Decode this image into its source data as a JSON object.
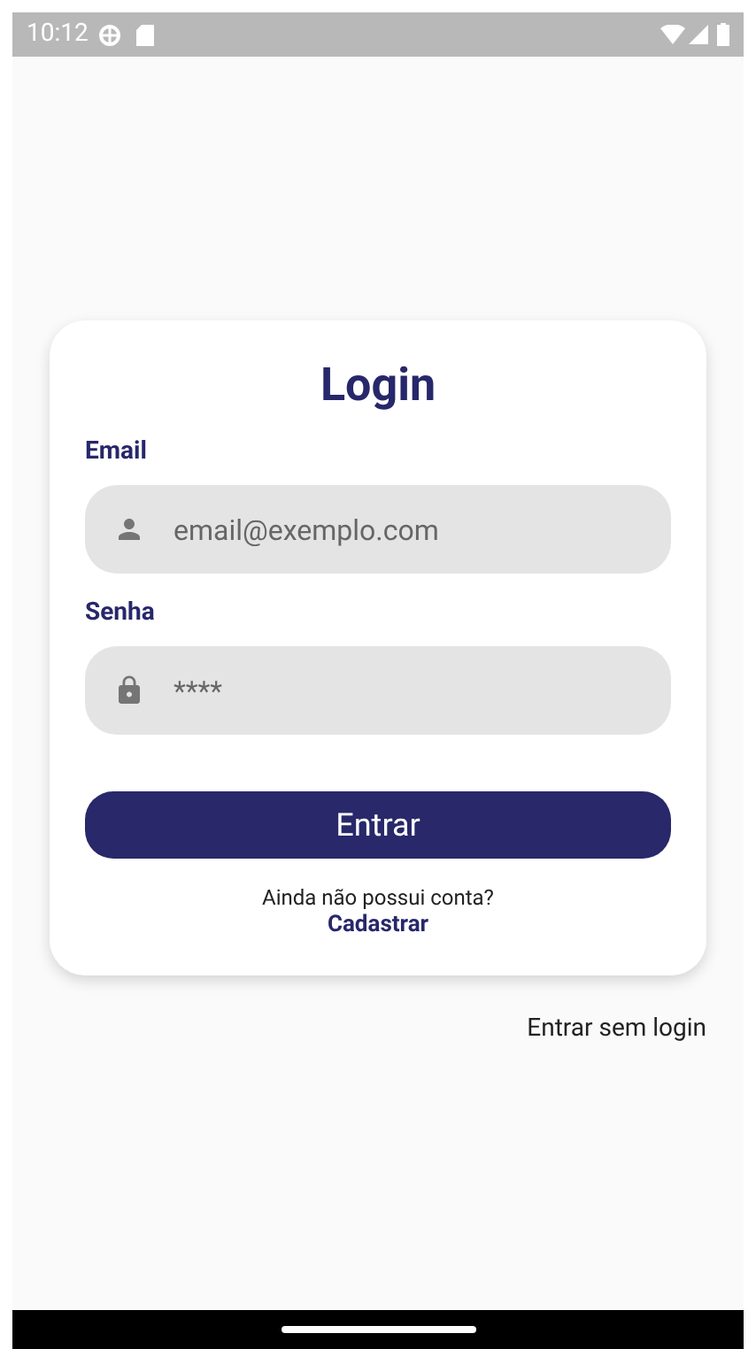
{
  "status_bar": {
    "time": "10:12"
  },
  "card": {
    "title": "Login",
    "fields": [
      {
        "label": "Email",
        "placeholder": "email@exemplo.com",
        "kind": "user"
      },
      {
        "label": "Senha",
        "placeholder": "****",
        "kind": "lock"
      }
    ],
    "submit": "Entrar",
    "signup_prompt": "Ainda não possui conta?",
    "signup_link": "Cadastrar"
  },
  "guest_link": "Entrar sem login"
}
